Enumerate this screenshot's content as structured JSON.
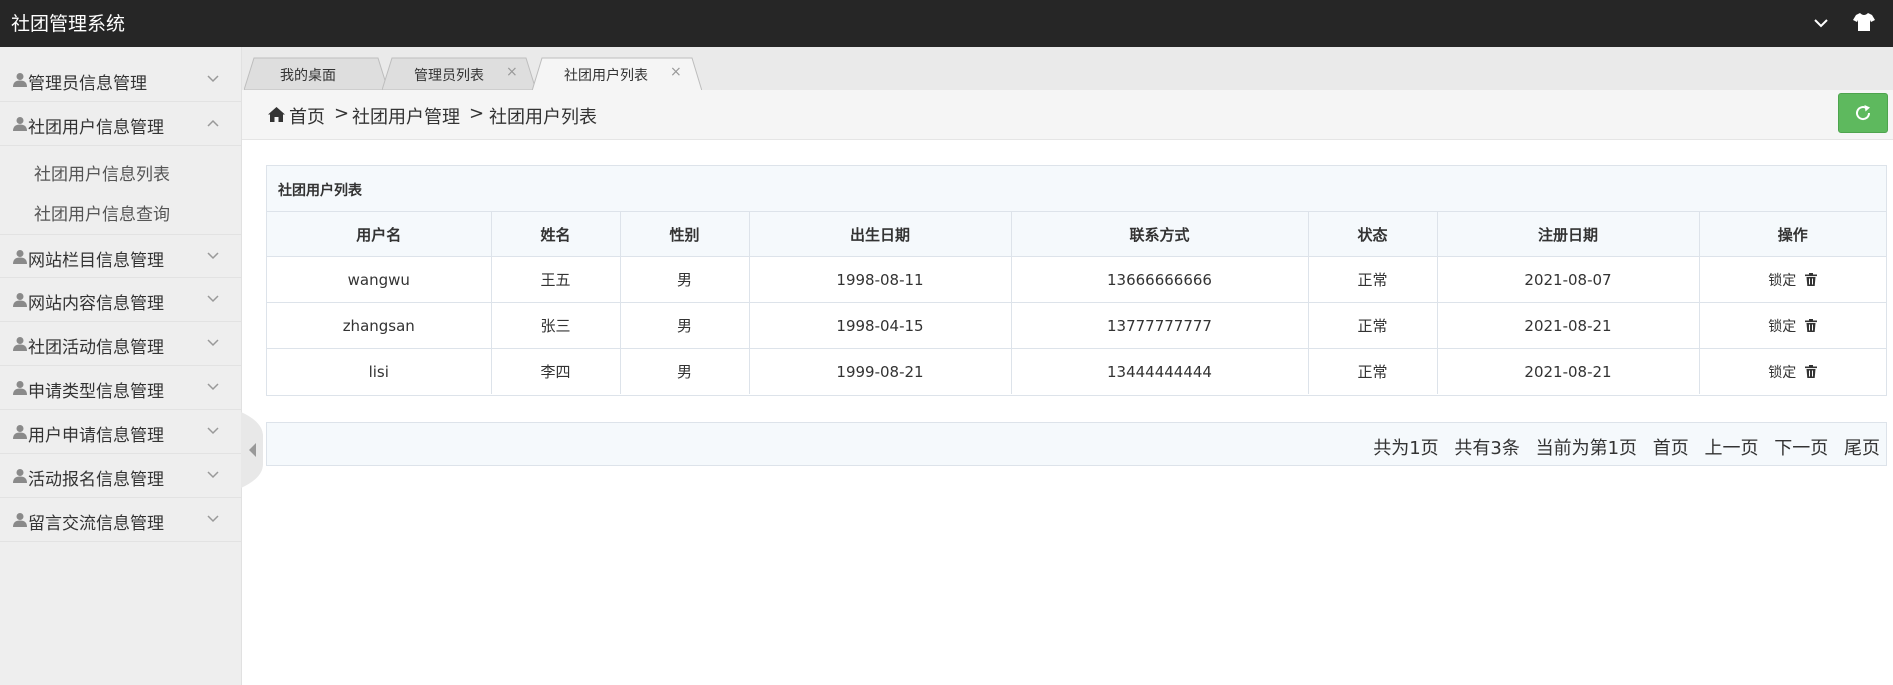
{
  "app": {
    "title": "社团管理系统"
  },
  "sidebar": {
    "items": [
      {
        "label": "管理员信息管理",
        "expanded": false
      },
      {
        "label": "社团用户信息管理",
        "expanded": true,
        "children": [
          "社团用户信息列表",
          "社团用户信息查询"
        ]
      },
      {
        "label": "网站栏目信息管理",
        "expanded": false
      },
      {
        "label": "网站内容信息管理",
        "expanded": false
      },
      {
        "label": "社团活动信息管理",
        "expanded": false
      },
      {
        "label": "申请类型信息管理",
        "expanded": false
      },
      {
        "label": "用户申请信息管理",
        "expanded": false
      },
      {
        "label": "活动报名信息管理",
        "expanded": false
      },
      {
        "label": "留言交流信息管理",
        "expanded": false
      }
    ]
  },
  "tabs": [
    {
      "label": "我的桌面",
      "closable": false,
      "active": false
    },
    {
      "label": "管理员列表",
      "close": "×",
      "closable": true,
      "active": false
    },
    {
      "label": "社团用户列表",
      "close": "×",
      "closable": true,
      "active": true
    }
  ],
  "breadcrumb": {
    "home": "首页",
    "sep": ">",
    "level1": "社团用户管理",
    "level2": "社团用户列表"
  },
  "table": {
    "title": "社团用户列表",
    "columns": [
      "用户名",
      "姓名",
      "性别",
      "出生日期",
      "联系方式",
      "状态",
      "注册日期",
      "操作"
    ],
    "rows": [
      [
        "wangwu",
        "王五",
        "男",
        "1998-08-11",
        "13666666666",
        "正常",
        "2021-08-07"
      ],
      [
        "zhangsan",
        "张三",
        "男",
        "1998-04-15",
        "13777777777",
        "正常",
        "2021-08-21"
      ],
      [
        "lisi",
        "李四",
        "男",
        "1999-08-21",
        "13444444444",
        "正常",
        "2021-08-21"
      ]
    ],
    "action_lock": "锁定"
  },
  "pager": {
    "total_pages": "共为1页",
    "total_records": "共有3条",
    "current": "当前为第1页",
    "first": "首页",
    "prev": "上一页",
    "next": "下一页",
    "last": "尾页"
  },
  "colors": {
    "topbar": "#262626",
    "sidebar": "#eeeeee",
    "refresh": "#5eb95e",
    "panel_head": "#f5f9fc"
  },
  "icons": [
    "chevron-down-icon",
    "shirt-icon",
    "user-icon",
    "home-icon",
    "refresh-icon",
    "trash-icon",
    "close-icon"
  ]
}
